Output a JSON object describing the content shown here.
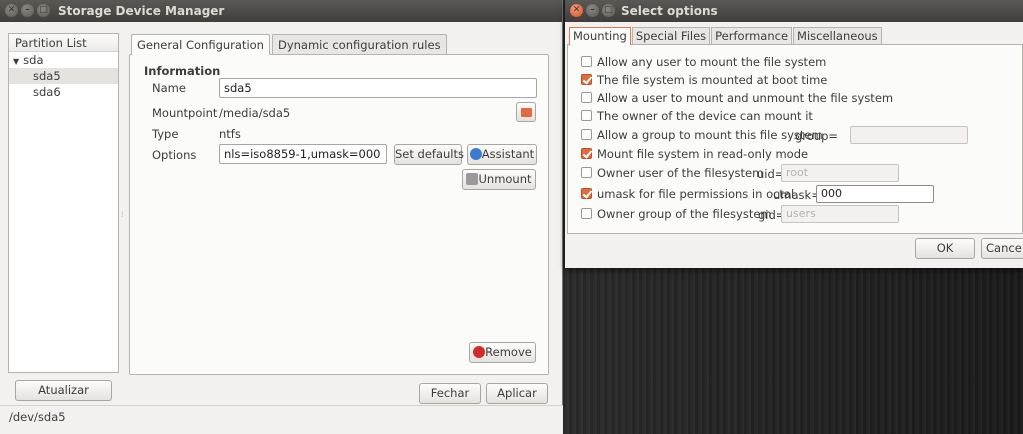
{
  "main_window": {
    "title": "Storage Device Manager",
    "partition_list_header": "Partition List",
    "tree": [
      {
        "label": "sda",
        "expanded": true
      },
      {
        "label": "sda5",
        "selected": true
      },
      {
        "label": "sda6"
      }
    ],
    "tabs": [
      "General Configuration",
      "Dynamic configuration rules"
    ],
    "info_header": "Information",
    "fields": {
      "name_label": "Name",
      "name_value": "sda5",
      "mountpoint_label": "Mountpoint",
      "mountpoint_value": "/media/sda5",
      "type_label": "Type",
      "type_value": "ntfs",
      "options_label": "Options",
      "options_value": "nls=iso8859-1,umask=000"
    },
    "buttons": {
      "set_defaults": "Set defaults",
      "assistant": "Assistant",
      "unmount": "Unmount",
      "remove": "Remove",
      "atualizar": "Atualizar",
      "fechar": "Fechar",
      "aplicar": "Aplicar"
    },
    "status": "/dev/sda5"
  },
  "options_dialog": {
    "title": "Select options",
    "tabs": [
      "Mounting",
      "Special Files",
      "Performance",
      "Miscellaneous"
    ],
    "options": [
      {
        "label": "Allow any user to mount the file system",
        "checked": false
      },
      {
        "label": "The file system is mounted at boot time",
        "checked": true
      },
      {
        "label": "Allow a user to mount and unmount the file system",
        "checked": false
      },
      {
        "label": "The owner of the device can mount it",
        "checked": false
      },
      {
        "label": "Allow a group to mount this file system",
        "checked": false,
        "field_label": "group=",
        "field_value": ""
      },
      {
        "label": "Mount file system in read-only mode",
        "checked": true
      },
      {
        "label": "Owner user of the filesystem",
        "checked": false,
        "field_label": "uid=",
        "field_value": "root"
      },
      {
        "label": "umask for file permissions in octal",
        "checked": true,
        "field_label": "umask=",
        "field_value": "000"
      },
      {
        "label": "Owner group of the filesystem",
        "checked": false,
        "field_label": "gid=",
        "field_value": "users"
      }
    ],
    "buttons": {
      "ok": "OK",
      "cancel": "Cance"
    }
  },
  "colors": {
    "accent": "#e36a3f",
    "titlebar": "#3f3e3a",
    "window_bg": "#f2f1f0"
  }
}
